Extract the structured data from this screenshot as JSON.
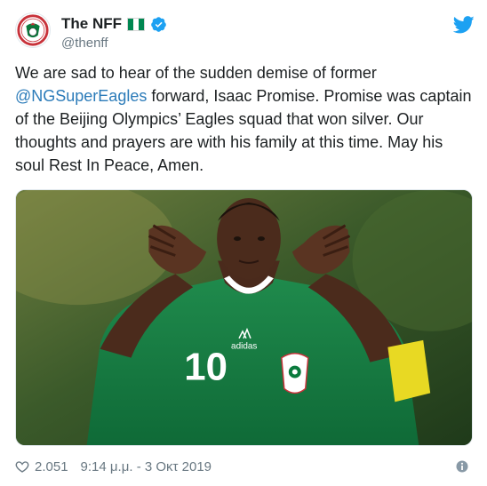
{
  "header": {
    "display_name": "The NFF",
    "handle": "@thenff",
    "flag_colors": [
      "#008751",
      "#ffffff",
      "#008751"
    ],
    "verified_color": "#1da1f2",
    "twitter_color": "#1da1f2"
  },
  "tweet": {
    "text_part1": "We are sad to hear of the sudden demise of former ",
    "mention": "@NGSuperEagles",
    "text_part2": " forward, Isaac Promise. Promise was captain of the Beijing Olympics’ Eagles squad that won silver. Our thoughts and prayers are with his family at this time. May his soul Rest In Peace, Amen."
  },
  "media": {
    "jersey_number": "10",
    "jersey_brand": "adidas"
  },
  "footer": {
    "like_count": "2.051",
    "timestamp": "9:14 μ.μ. - 3 Οκτ 2019"
  },
  "icons": {
    "avatar": "nff-logo-icon",
    "verified": "verified-badge-icon",
    "twitter": "twitter-bird-icon",
    "like": "heart-icon",
    "info": "info-icon"
  }
}
